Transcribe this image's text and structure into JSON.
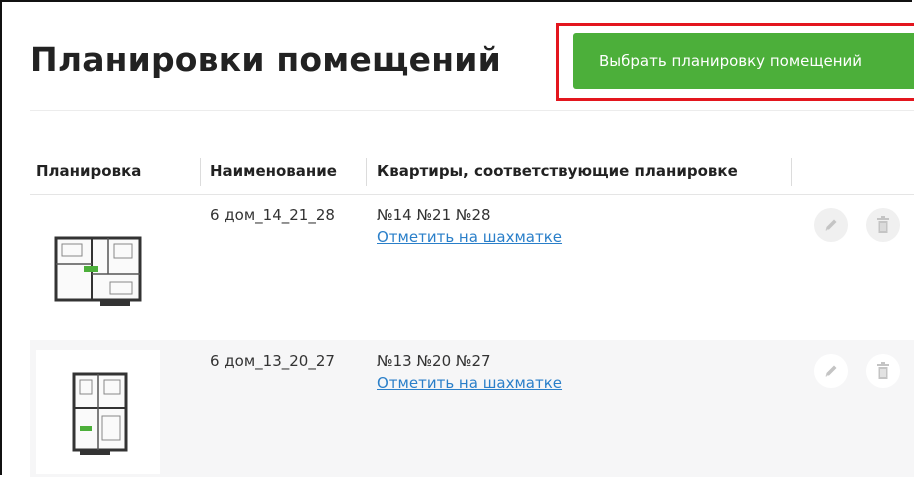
{
  "page": {
    "title": "Планировки помещений"
  },
  "toolbar": {
    "select_layout_label": "Выбрать планировку помещений"
  },
  "table": {
    "columns": [
      "Планировка",
      "Наименование",
      "Квартиры, соответствующие планировке"
    ],
    "rows": [
      {
        "name": "6 дом_14_21_28",
        "apartments": "№14 №21 №28",
        "mark_link": "Отметить на шахматке"
      },
      {
        "name": "6 дом_13_20_27",
        "apartments": "№13 №20 №27",
        "mark_link": "Отметить на шахматке"
      }
    ]
  },
  "icons": {
    "edit": "pencil-icon",
    "delete": "trash-icon"
  },
  "colors": {
    "accent": "#4caf3a",
    "highlight": "#e3161e",
    "link": "#2a7fc9"
  }
}
